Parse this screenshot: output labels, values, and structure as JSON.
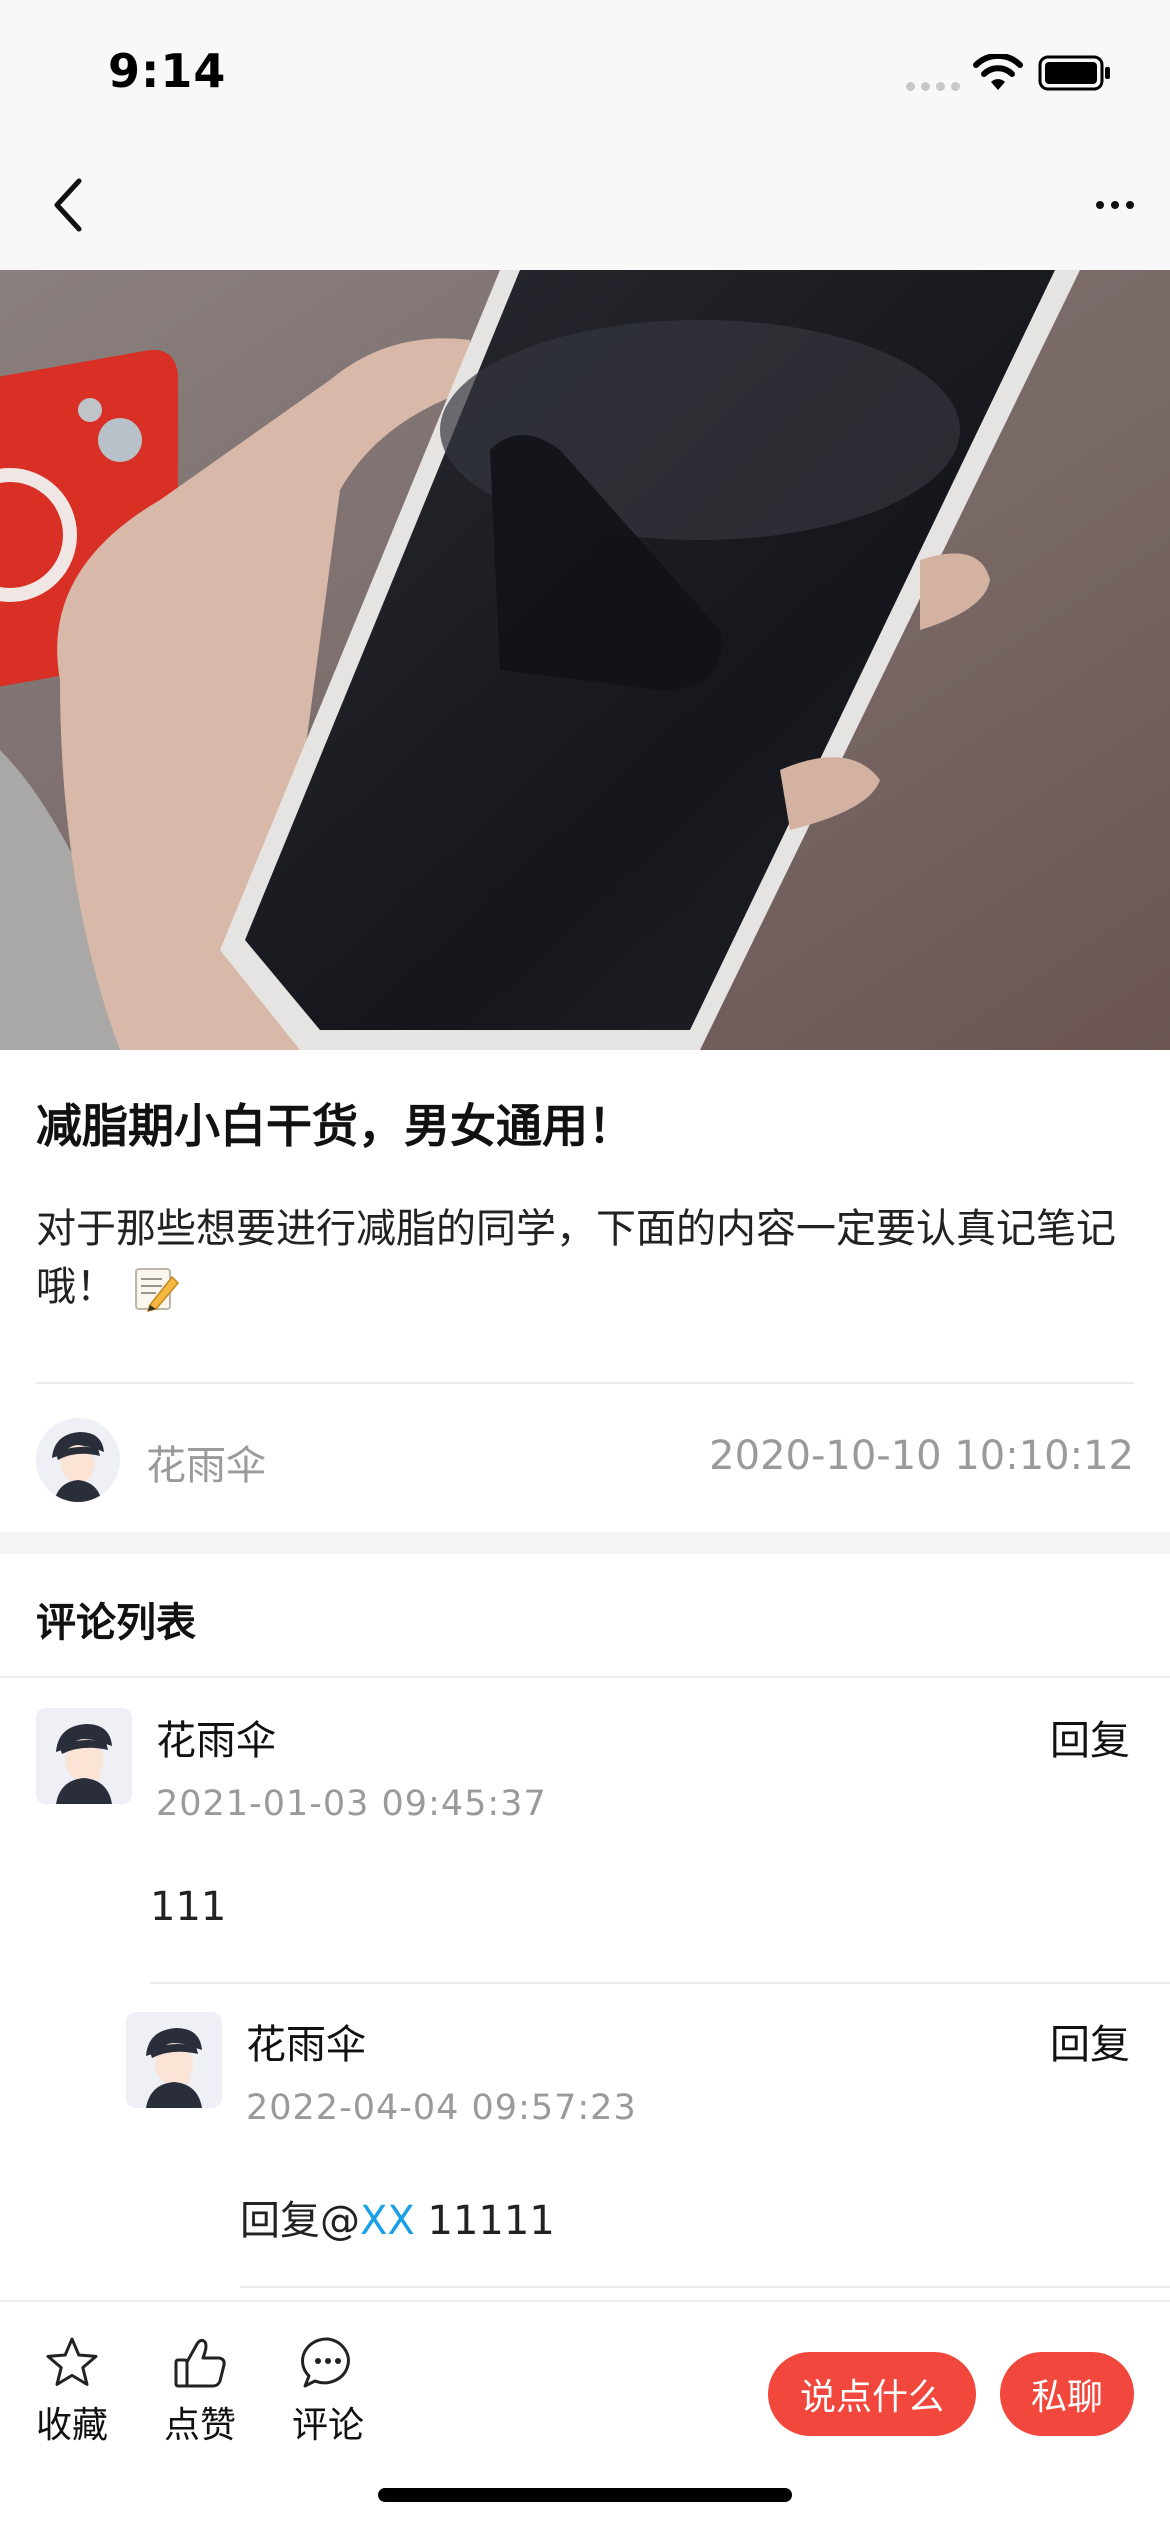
{
  "status_bar": {
    "time": "9:14"
  },
  "post": {
    "title": "减脂期小白干货，男女通用！",
    "body": "对于那些想要进行减脂的同学，下面的内容一定要认真记笔记哦！",
    "author": "花雨伞",
    "time": "2020-10-10 10:10:12"
  },
  "comments_section": {
    "heading": "评论列表",
    "comments": [
      {
        "name": "花雨伞",
        "time": "2021-01-03 09:45:37",
        "text": "111",
        "reply_label": "回复",
        "replies": [
          {
            "name": "花雨伞",
            "time": "2022-04-04 09:57:23",
            "prefix": "回复@",
            "mention": "XX",
            "text": "11111",
            "reply_label": "回复"
          }
        ]
      }
    ]
  },
  "bottom_bar": {
    "favorite_label": "收藏",
    "like_label": "点赞",
    "comment_label": "评论",
    "say_label": "说点什么",
    "chat_label": "私聊"
  },
  "colors": {
    "accent": "#f2473d",
    "mention": "#1aa0e6",
    "muted_text": "#9a9a9a"
  }
}
